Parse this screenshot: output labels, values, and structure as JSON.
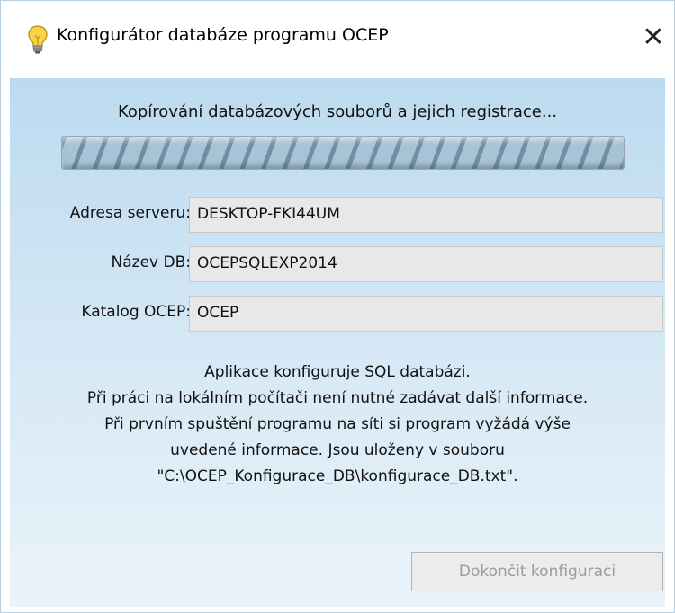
{
  "window": {
    "title": "Konfigurátor databáze programu OCEP",
    "close_label": "✕"
  },
  "status": {
    "text": "Kopírování databázových souborů a jejich registrace...",
    "progress_percent": 100
  },
  "form": {
    "fields": [
      {
        "label": "Adresa serveru:",
        "value": "DESKTOP-FKI44UM"
      },
      {
        "label": "Název DB:",
        "value": "OCEPSQLEXP2014"
      },
      {
        "label": "Katalog OCEP:",
        "value": "OCEP"
      }
    ]
  },
  "info": {
    "lines": [
      "Aplikace konfiguruje SQL databázi.",
      "Při práci na lokálním počítači není nutné zadávat další informace.",
      "Při prvním spuštění programu na síti si program vyžádá výše",
      "uvedené informace. Jsou uloženy v souboru",
      "\"C:\\OCEP_Konfigurace_DB\\konfigurace_DB.txt\"."
    ]
  },
  "buttons": {
    "finish_label": "Dokončit konfiguraci",
    "finish_enabled": false
  },
  "icons": {
    "app": "lightbulb-icon",
    "close": "close-icon"
  }
}
